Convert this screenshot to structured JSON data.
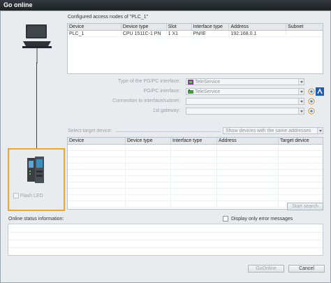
{
  "window": {
    "title": "Go online"
  },
  "configured": {
    "heading": "Configured access nodes of \"PLC_1\"",
    "columns": [
      "Device",
      "Device type",
      "Slot",
      "Interface type",
      "Address",
      "Subnet"
    ],
    "rows": [
      [
        "PLC_1",
        "CPU 1511C-1 PN",
        "1 X1",
        "PN/IE",
        "192.168.0.1",
        ""
      ]
    ]
  },
  "interface": {
    "type_label": "Type of the PG/PC interface:",
    "type_value": "TeleService",
    "pgpc_label": "PG/PC interface:",
    "pgpc_value": "TeleService",
    "connection_label": "Connection to interface/subnet:",
    "gateway_label": "1st gateway:"
  },
  "target": {
    "select_label": "Select target device:",
    "filter_value": "Show devices with the same addresses",
    "columns": [
      "Device",
      "Device type",
      "Interface type",
      "Address",
      "Target device"
    ]
  },
  "device": {
    "flash_led_label": "Flash LED"
  },
  "buttons": {
    "start_search": "Start search",
    "go_online": "GoOnline",
    "cancel": "Cancel"
  },
  "status": {
    "label": "Online status information:",
    "error_only_label": "Display only error messages"
  }
}
